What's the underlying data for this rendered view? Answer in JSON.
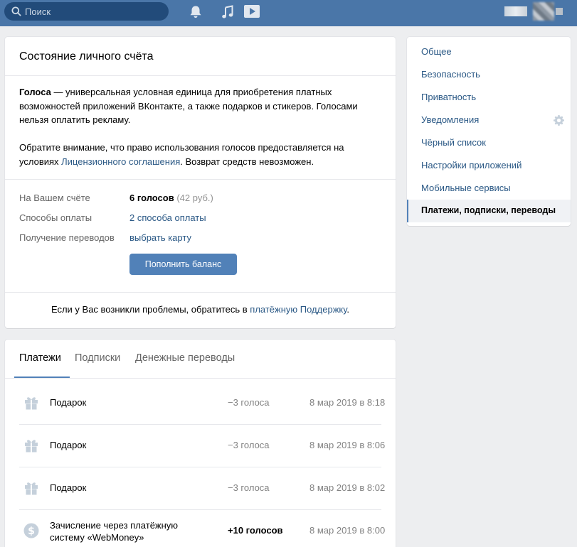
{
  "header": {
    "search_placeholder": "Поиск",
    "icons": [
      "search-icon",
      "bell-icon",
      "music-icon",
      "video-icon"
    ],
    "accent_color": "#4a76a8"
  },
  "balance_card": {
    "title": "Состояние личного счёта",
    "intro_bold": "Голоса",
    "intro_rest": " — универсальная условная единица для приобретения платных возможностей приложений ВКонтакте, а также подарков и стикеров. Голосами нельзя оплатить рекламу.",
    "notice_start": "Обратите внимание, что право использования голосов предоставляется на условиях ",
    "notice_link": "Лицензионного соглашения",
    "notice_end": ". Возврат средств невозможен.",
    "rows": [
      {
        "label": "На Вашем счёте",
        "value_bold": "6 голосов",
        "value_muted": " (42 руб.)"
      },
      {
        "label": "Способы оплаты",
        "value_link": "2 способа оплаты"
      },
      {
        "label": "Получение переводов",
        "value_link": "выбрать карту"
      }
    ],
    "topup_button": "Пополнить баланс",
    "support_start": "Если у Вас возникли проблемы, обратитесь в ",
    "support_link": "платёжную Поддержку",
    "support_end": "."
  },
  "transactions": {
    "tabs": [
      {
        "label": "Платежи",
        "active": true
      },
      {
        "label": "Подписки",
        "active": false
      },
      {
        "label": "Денежные переводы",
        "active": false
      }
    ],
    "rows": [
      {
        "icon": "gift-icon",
        "title_line1": "Подарок",
        "title_line2": "",
        "amount": "−3 голоса",
        "date": "8 мар 2019 в 8:18"
      },
      {
        "icon": "gift-icon",
        "title_line1": "Подарок",
        "title_line2": "",
        "amount": "−3 голоса",
        "date": "8 мар 2019 в 8:06"
      },
      {
        "icon": "gift-icon",
        "title_line1": "Подарок",
        "title_line2": "",
        "amount": "−3 голоса",
        "date": "8 мар 2019 в 8:02"
      },
      {
        "icon": "dollar-icon",
        "title_line1": "Зачисление через платёжную",
        "title_line2": "систему «WebMoney»",
        "amount": "+10 голосов",
        "date": "8 мар 2019 в 8:00"
      }
    ]
  },
  "settings_menu": {
    "items": [
      {
        "label": "Общее"
      },
      {
        "label": "Безопасность"
      },
      {
        "label": "Приватность"
      },
      {
        "label": "Уведомления"
      },
      {
        "label": "Чёрный список"
      },
      {
        "label": "Настройки приложений"
      },
      {
        "label": "Мобильные сервисы"
      },
      {
        "label": "Платежи, подписки, переводы"
      }
    ],
    "active_index": 7
  }
}
